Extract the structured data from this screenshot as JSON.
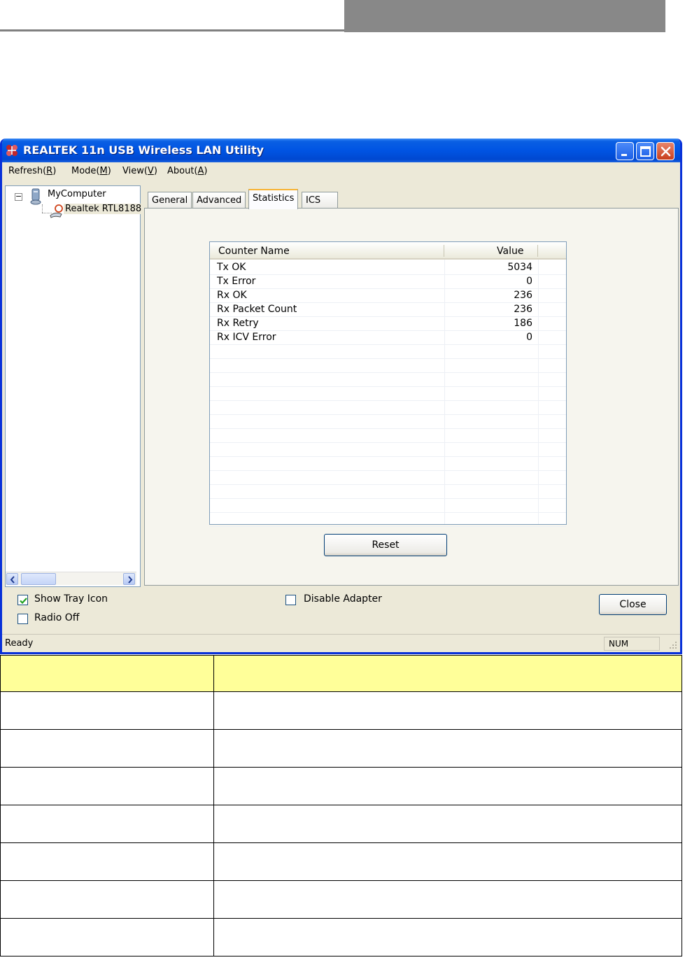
{
  "window": {
    "title": "REALTEK 11n USB Wireless LAN Utility",
    "controls": [
      "minimize-icon",
      "maximize-icon",
      "close-icon"
    ]
  },
  "menu": {
    "refresh": {
      "pre": "Refresh(",
      "key": "R",
      "post": ")"
    },
    "mode": {
      "pre": "Mode(",
      "key": "M",
      "post": ")"
    },
    "view": {
      "pre": "View(",
      "key": "V",
      "post": ")"
    },
    "about": {
      "pre": "About(",
      "key": "A",
      "post": ")"
    }
  },
  "tree": {
    "expander": "−",
    "root": "MyComputer",
    "child": "Realtek RTL8188"
  },
  "tabs": [
    {
      "label": "General"
    },
    {
      "label": "Advanced"
    },
    {
      "label": "Statistics",
      "active": true
    },
    {
      "label": "ICS"
    }
  ],
  "statistics": {
    "columns": {
      "name": "Counter Name",
      "value": "Value"
    },
    "rows": [
      {
        "name": "Tx OK",
        "value": "5034"
      },
      {
        "name": "Tx Error",
        "value": "0"
      },
      {
        "name": "Rx OK",
        "value": "236"
      },
      {
        "name": "Rx Packet Count",
        "value": "236"
      },
      {
        "name": "Rx Retry",
        "value": "186"
      },
      {
        "name": "Rx ICV Error",
        "value": "0"
      }
    ],
    "reset_label": "Reset"
  },
  "options": {
    "show_tray_icon": {
      "label": "Show Tray Icon",
      "checked": true
    },
    "radio_off": {
      "label": "Radio Off",
      "checked": false
    },
    "disable_adapter": {
      "label": "Disable Adapter",
      "checked": false
    }
  },
  "close_label": "Close",
  "status": {
    "text": "Ready",
    "indicator": "NUM"
  },
  "colors": {
    "titlebar": "#0054e3",
    "table_header": "#ffff99",
    "tab_accent": "#f8b332"
  }
}
